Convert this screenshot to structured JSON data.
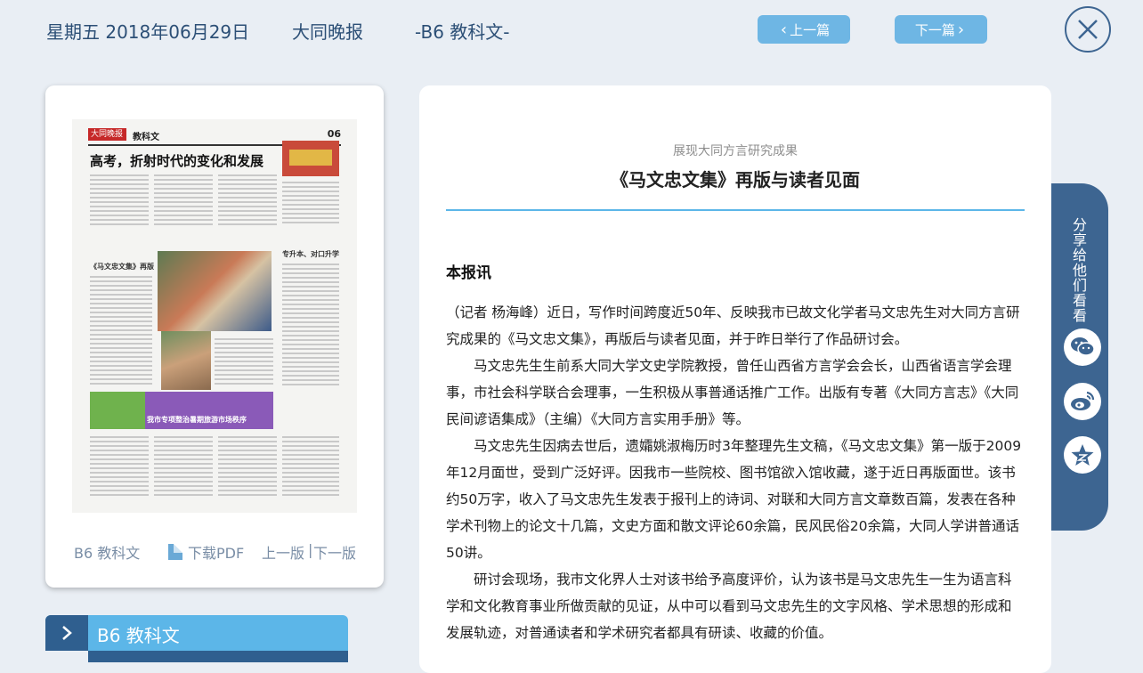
{
  "header": {
    "date": "星期五 2018年06月29日",
    "paper": "大同晚报",
    "page": "-B6 教科文-",
    "prev_label": "上一篇",
    "next_label": "下一篇"
  },
  "thumbnail": {
    "logo": "大同晚报",
    "column": "教科文",
    "page_no": "06",
    "headline": "高考，折射时代的变化和发展",
    "sub1": "《马文忠文集》再版",
    "sub2": "专升本、对口升学",
    "ad_text": "我市专项整治暑期旅游市场秩序"
  },
  "card_footer": {
    "page_label": "B6 教科文",
    "pdf_label": "下载PDF",
    "prev_page": "上一版",
    "separator": "|",
    "next_page": "下一版"
  },
  "section": {
    "label": "B6 教科文"
  },
  "article": {
    "kicker": "展现大同方言研究成果",
    "title": "《马文忠文集》再版与读者见面",
    "byline": "本报讯",
    "paragraphs": [
      "（记者  杨海峰）近日，写作时间跨度近50年、反映我市已故文化学者马文忠先生对大同方言研究成果的《马文忠文集》，再版后与读者见面，并于昨日举行了作品研讨会。",
      "马文忠先生生前系大同大学文史学院教授，曾任山西省方言学会会长，山西省语言学会理事，市社会科学联合会理事，一生积极从事普通话推广工作。出版有专著《大同方言志》《大同民间谚语集成》（主编）《大同方言实用手册》等。",
      "马文忠先生因病去世后，遗孀姚淑梅历时3年整理先生文稿，《马文忠文集》第一版于2009年12月面世，受到广泛好评。因我市一些院校、图书馆欲入馆收藏，遂于近日再版面世。该书约50万字，收入了马文忠先生发表于报刊上的诗词、对联和大同方言文章数百篇，发表在各种学术刊物上的论文十几篇，文史方面和散文评论60余篇，民风民俗20余篇，大同人学讲普通话50讲。",
      "研讨会现场，我市文化界人士对该书给予高度评价，认为该书是马文忠先生一生为语言科学和文化教育事业所做贡献的见证，从中可以看到马文忠先生的文字风格、学术思想的形成和发展轨迹，对普通读者和学术研究者都具有研读、收藏的价值。"
    ]
  },
  "share": {
    "label": "分享给他们看看",
    "icons": [
      "wechat-icon",
      "weibo-icon",
      "favorite-icon"
    ]
  },
  "colors": {
    "accent": "#5cb6e8",
    "nav_button": "#6eb6e4",
    "dark_blue": "#3d6591",
    "background": "#e9eef4"
  }
}
